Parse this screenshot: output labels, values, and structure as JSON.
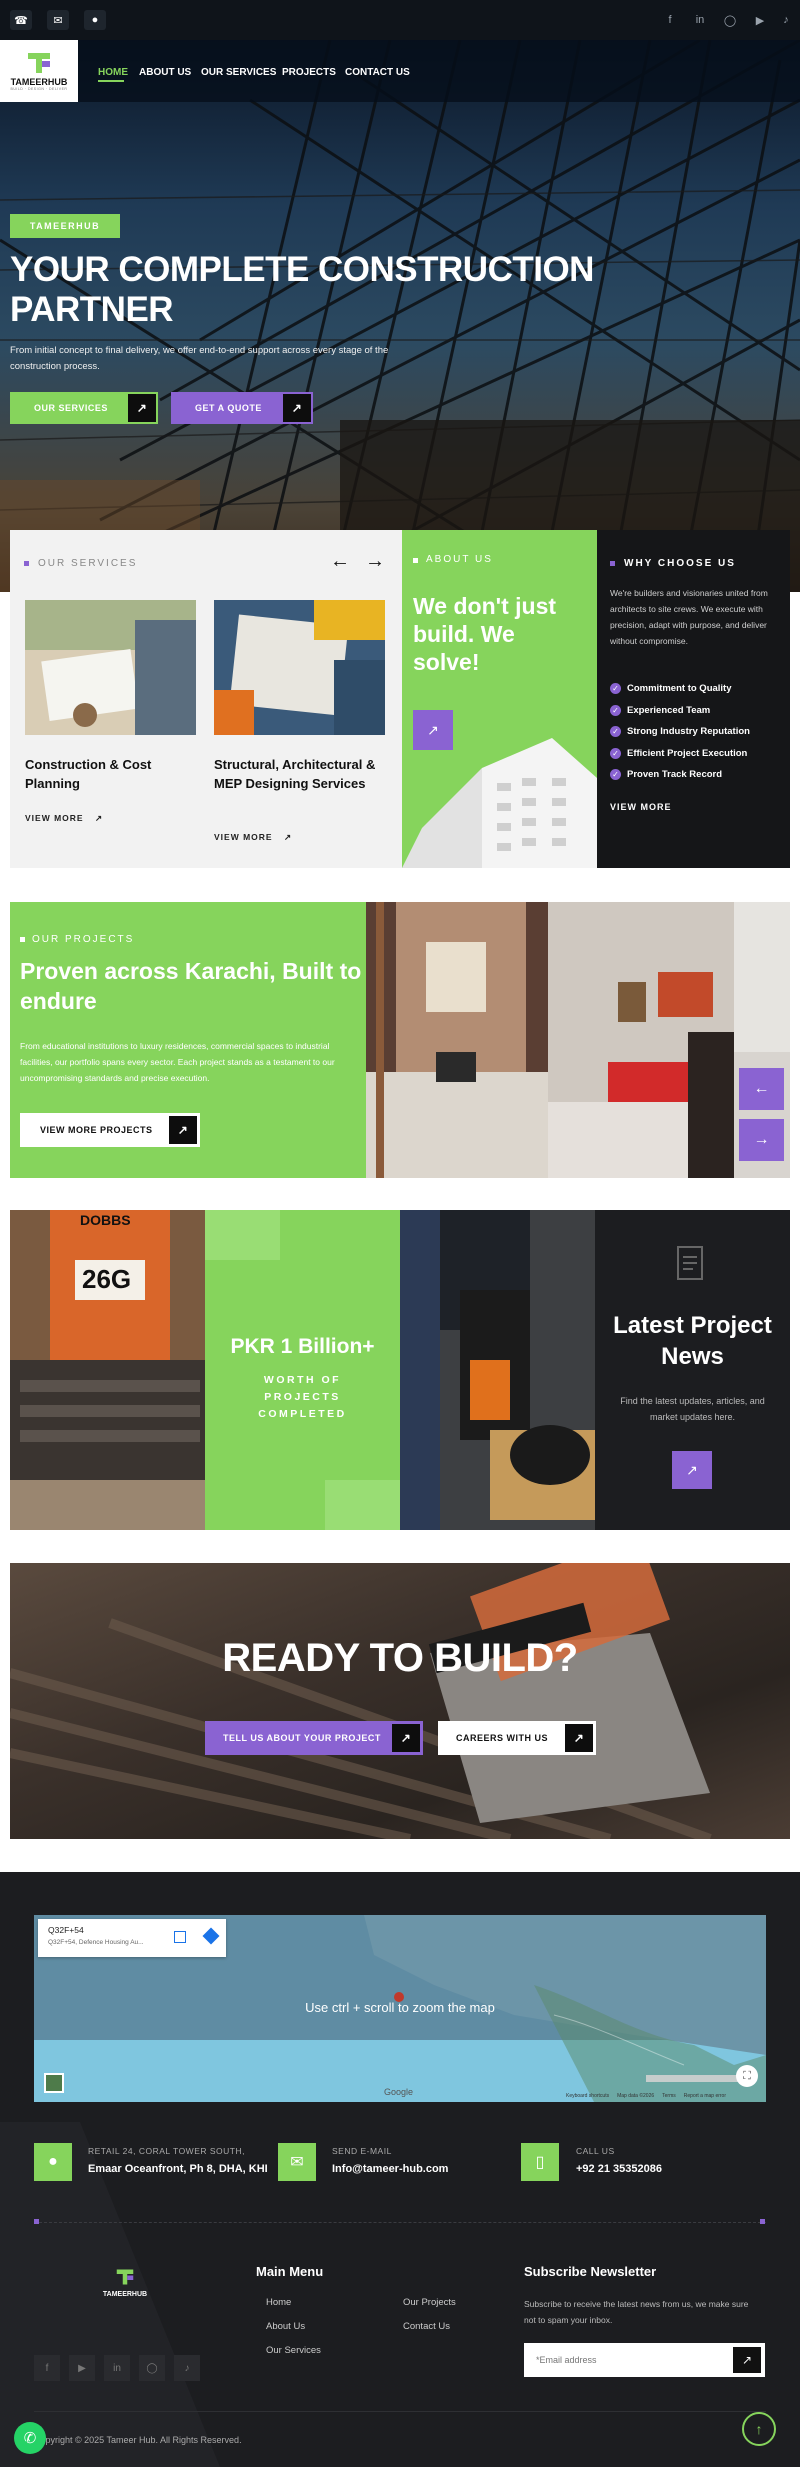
{
  "topbar": {
    "phone_icon": "phone-icon",
    "mail_icon": "mail-icon",
    "location_icon": "location-icon",
    "social": [
      "facebook-icon",
      "linkedin-icon",
      "instagram-icon",
      "youtube-icon",
      "tiktok-icon"
    ]
  },
  "brand": {
    "name": "TAMEERHUB",
    "tagline": "BUILD · DESIGN · DELIVER",
    "accent": "#86d45c",
    "purple": "#8a63d2"
  },
  "nav": {
    "items": [
      "HOME",
      "ABOUT US",
      "OUR SERVICES",
      "PROJECTS",
      "CONTACT US"
    ]
  },
  "hero": {
    "tag": "TAMEERHUB",
    "title_line1": "YOUR COMPLETE CONSTRUCTION",
    "title_line2": "PARTNER",
    "subtitle": "From initial concept to final delivery, we offer end-to-end support across every stage of the construction process.",
    "btn_services": "OUR SERVICES",
    "btn_quote": "GET A QUOTE"
  },
  "services": {
    "label": "OUR SERVICES",
    "cards": [
      {
        "title": "Construction & Cost Planning",
        "link": "VIEW MORE"
      },
      {
        "title": "Structural, Architectural & MEP Designing Services",
        "link": "VIEW MORE"
      }
    ]
  },
  "about": {
    "label": "ABOUT US",
    "heading": "We don't just build. We solve!"
  },
  "why": {
    "label": "WHY CHOOSE US",
    "text": "We're builders and visionaries united from architects to site crews. We execute with precision, adapt with purpose, and deliver without compromise.",
    "points": [
      "Commitment to Quality",
      "Experienced Team",
      "Strong Industry Reputation",
      "Efficient Project Execution",
      "Proven Track Record"
    ],
    "link": "VIEW MORE"
  },
  "projects": {
    "label": "OUR PROJECTS",
    "heading": "Proven across Karachi, Built to endure",
    "text": "From educational institutions to luxury residences, commercial spaces to industrial facilities, our portfolio spans every sector. Each project stands as a testament to our uncompromising standards and precise execution.",
    "button": "VIEW MORE PROJECTS"
  },
  "stats": {
    "value": "PKR 1 Billion+",
    "caption": "WORTH OF PROJECTS COMPLETED",
    "machine_label": "DOBBS",
    "machine_model": "26G"
  },
  "news": {
    "title": "Latest Project News",
    "text": "Find the latest updates, articles, and market updates here."
  },
  "ready": {
    "title": "READY TO BUILD?",
    "btn_project": "TELL US ABOUT YOUR PROJECT",
    "btn_careers": "CAREERS WITH US"
  },
  "map": {
    "place_code": "Q32F+54",
    "place_address": "Q32F+54, Defence Housing Au...",
    "overlay": "Use ctrl + scroll to zoom the map",
    "attribution": [
      "Keyboard shortcuts",
      "Map data ©2026",
      "Terms",
      "Report a map error"
    ],
    "google": "Google"
  },
  "contacts": [
    {
      "label": "RETAIL 24, CORAL TOWER SOUTH,",
      "value": "Emaar Oceanfront, Ph 8, DHA, KHI"
    },
    {
      "label": "SEND E-MAIL",
      "value": "Info@tameer-hub.com"
    },
    {
      "label": "CALL US",
      "value": "+92 21 35352086"
    }
  ],
  "footer": {
    "menu_title": "Main Menu",
    "menu_col1": [
      "Home",
      "About Us",
      "Our Services"
    ],
    "menu_col2": [
      "Our Projects",
      "Contact Us"
    ],
    "newsletter_title": "Subscribe Newsletter",
    "newsletter_text": "Subscribe to receive the latest news from us, we make sure not to spam your inbox.",
    "email_placeholder": "*Email address",
    "copyright": "Copyright © 2025 Tameer Hub. All Rights Reserved."
  }
}
